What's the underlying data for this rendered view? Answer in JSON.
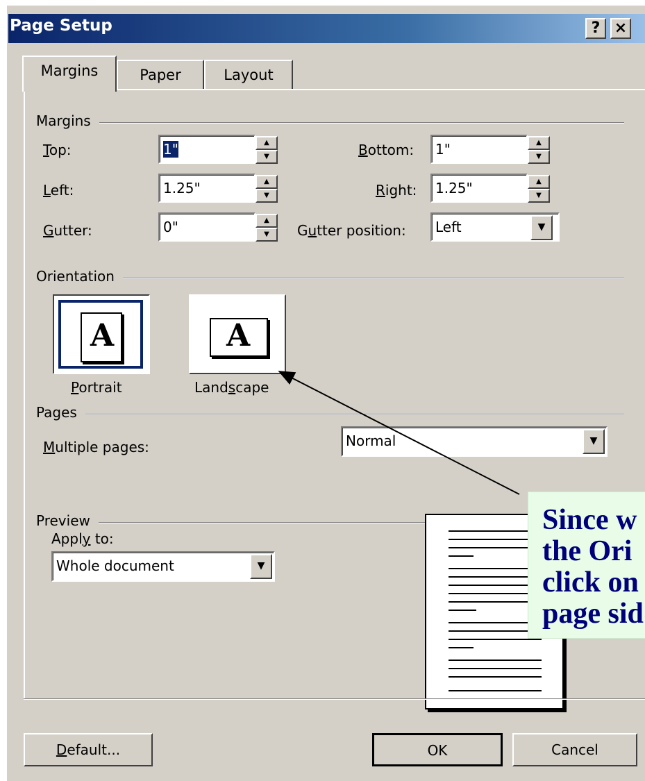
{
  "window": {
    "title": "Page Setup",
    "help_button": "?",
    "close_button": "×"
  },
  "tabs": [
    {
      "label": "Margins",
      "selected": true
    },
    {
      "label": "Paper",
      "selected": false
    },
    {
      "label": "Layout",
      "selected": false
    }
  ],
  "margins": {
    "group_label": "Margins",
    "top": {
      "label": "Top:",
      "value": "1\""
    },
    "bottom": {
      "label": "Bottom:",
      "value": "1\""
    },
    "left": {
      "label": "Left:",
      "value": "1.25\""
    },
    "right": {
      "label": "Right:",
      "value": "1.25\""
    },
    "gutter": {
      "label": "Gutter:",
      "value": "0\""
    },
    "gutter_position": {
      "label": "Gutter position:",
      "value": "Left"
    }
  },
  "orientation": {
    "group_label": "Orientation",
    "portrait_label": "Portrait",
    "landscape_label": "Landscape",
    "icon_letter": "A",
    "selected": "portrait"
  },
  "pages": {
    "group_label": "Pages",
    "multiple_pages_label": "Multiple pages:",
    "multiple_pages_value": "Normal"
  },
  "preview": {
    "group_label": "Preview",
    "apply_to_label": "Apply to:",
    "apply_to_value": "Whole document"
  },
  "buttons": {
    "default": "Default...",
    "ok": "OK",
    "cancel": "Cancel"
  },
  "callout": {
    "lines": [
      "Since w",
      "the Ori",
      "click on",
      "page sid"
    ],
    "background": "#e8fce8",
    "text_color": "#00007a"
  },
  "colors": {
    "dialog_face": "#d4d0c8",
    "titlebar": "#0a246a"
  },
  "icons": [
    "question-mark-icon",
    "close-icon",
    "spin-up-icon",
    "spin-down-icon",
    "dropdown-arrow-icon",
    "portrait-page-icon",
    "landscape-page-icon",
    "arrow-annotation"
  ]
}
